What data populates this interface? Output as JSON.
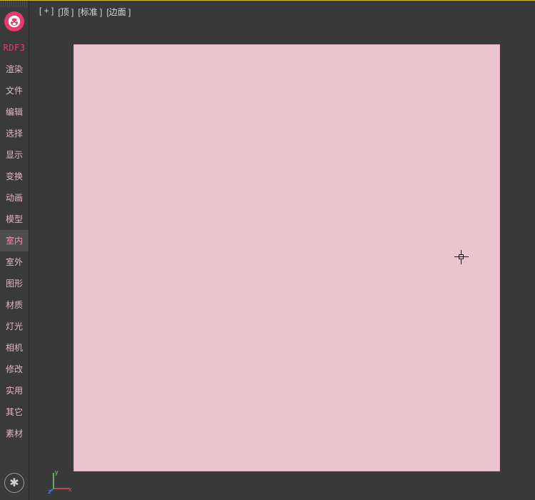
{
  "app": {
    "title": "RDF3"
  },
  "sidebar": {
    "header": "RDF3",
    "items": [
      {
        "label": "渲染",
        "active": false
      },
      {
        "label": "文件",
        "active": false
      },
      {
        "label": "编辑",
        "active": false
      },
      {
        "label": "选择",
        "active": false
      },
      {
        "label": "显示",
        "active": false
      },
      {
        "label": "变换",
        "active": false
      },
      {
        "label": "动画",
        "active": false
      },
      {
        "label": "模型",
        "active": false
      },
      {
        "label": "室内",
        "active": true
      },
      {
        "label": "室外",
        "active": false
      },
      {
        "label": "图形",
        "active": false
      },
      {
        "label": "材质",
        "active": false
      },
      {
        "label": "灯光",
        "active": false
      },
      {
        "label": "相机",
        "active": false
      },
      {
        "label": "修改",
        "active": false
      },
      {
        "label": "实用",
        "active": false
      },
      {
        "label": "其它",
        "active": false
      },
      {
        "label": "素材",
        "active": false
      }
    ]
  },
  "viewport": {
    "labels": {
      "plus": "[ + ]",
      "view": "[顶 ]",
      "mode": "[标准 ]",
      "shading": "[边面 ]"
    },
    "plane_color": "#ecc4d0",
    "axes": {
      "x": "x",
      "y": "y",
      "z": "z"
    }
  },
  "icons": {
    "settings_glyph": "✱"
  }
}
